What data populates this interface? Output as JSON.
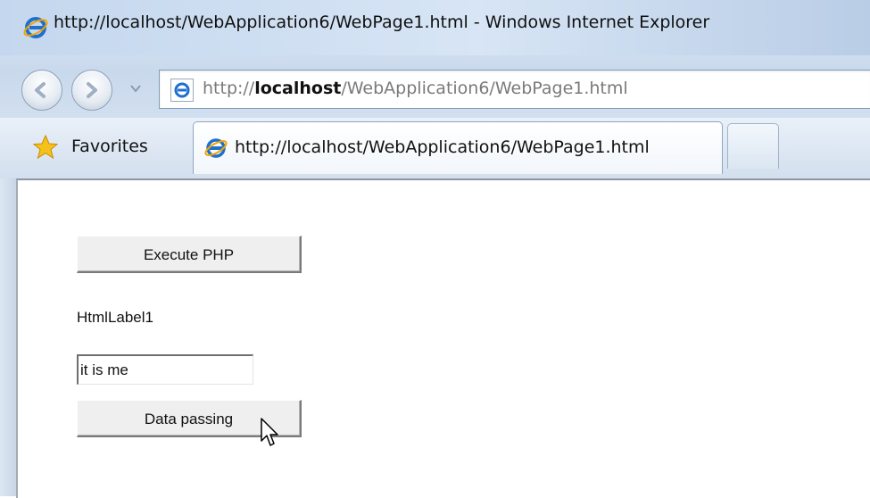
{
  "window": {
    "title": "http://localhost/WebApplication6/WebPage1.html - Windows Internet Explorer"
  },
  "address": {
    "prefix": "http://",
    "host": "localhost",
    "path": "/WebApplication6/WebPage1.html"
  },
  "favorites": {
    "label": "Favorites"
  },
  "tab": {
    "label": "http://localhost/WebApplication6/WebPage1.html"
  },
  "page": {
    "execute_button": "Execute PHP",
    "label": "HtmlLabel1",
    "input_value": "it is me",
    "data_button": "Data passing"
  },
  "colors": {
    "ie_blue": "#1e6fd0",
    "star_yellow": "#f5c21b",
    "chrome_blue": "#c9d9ec"
  },
  "icons": [
    "ie-logo-icon",
    "back-arrow-icon",
    "forward-arrow-icon",
    "chevron-down-icon",
    "page-icon",
    "star-icon",
    "mouse-pointer-icon"
  ]
}
